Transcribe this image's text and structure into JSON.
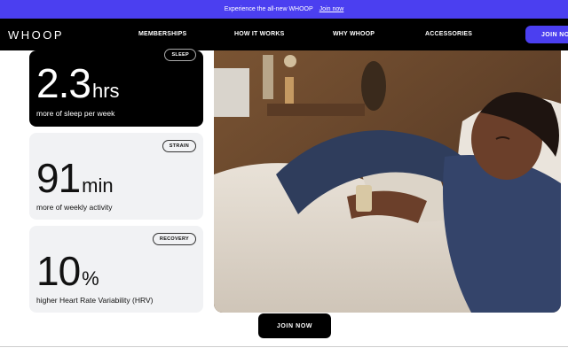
{
  "banner": {
    "text": "Experience the all-new WHOOP",
    "link": "Join now"
  },
  "nav": {
    "logo": "WHOOP",
    "links": [
      "MEMBERSHIPS",
      "HOW IT WORKS",
      "WHY WHOOP",
      "ACCESSORIES"
    ],
    "join": "JOIN NOW"
  },
  "stats": [
    {
      "tag": "SLEEP",
      "value": "2.3",
      "unit": "hrs",
      "desc": "more of sleep per week"
    },
    {
      "tag": "STRAIN",
      "value": "91",
      "unit": "min",
      "desc": "more of weekly activity"
    },
    {
      "tag": "RECOVERY",
      "value": "10",
      "unit": "%",
      "desc": "higher Heart Rate Variability (HRV)"
    }
  ],
  "cta": {
    "label": "JOIN NOW"
  },
  "colors": {
    "accent": "#4b3ff0",
    "nav_bg": "#000000",
    "card_bg": "#f1f2f4"
  }
}
